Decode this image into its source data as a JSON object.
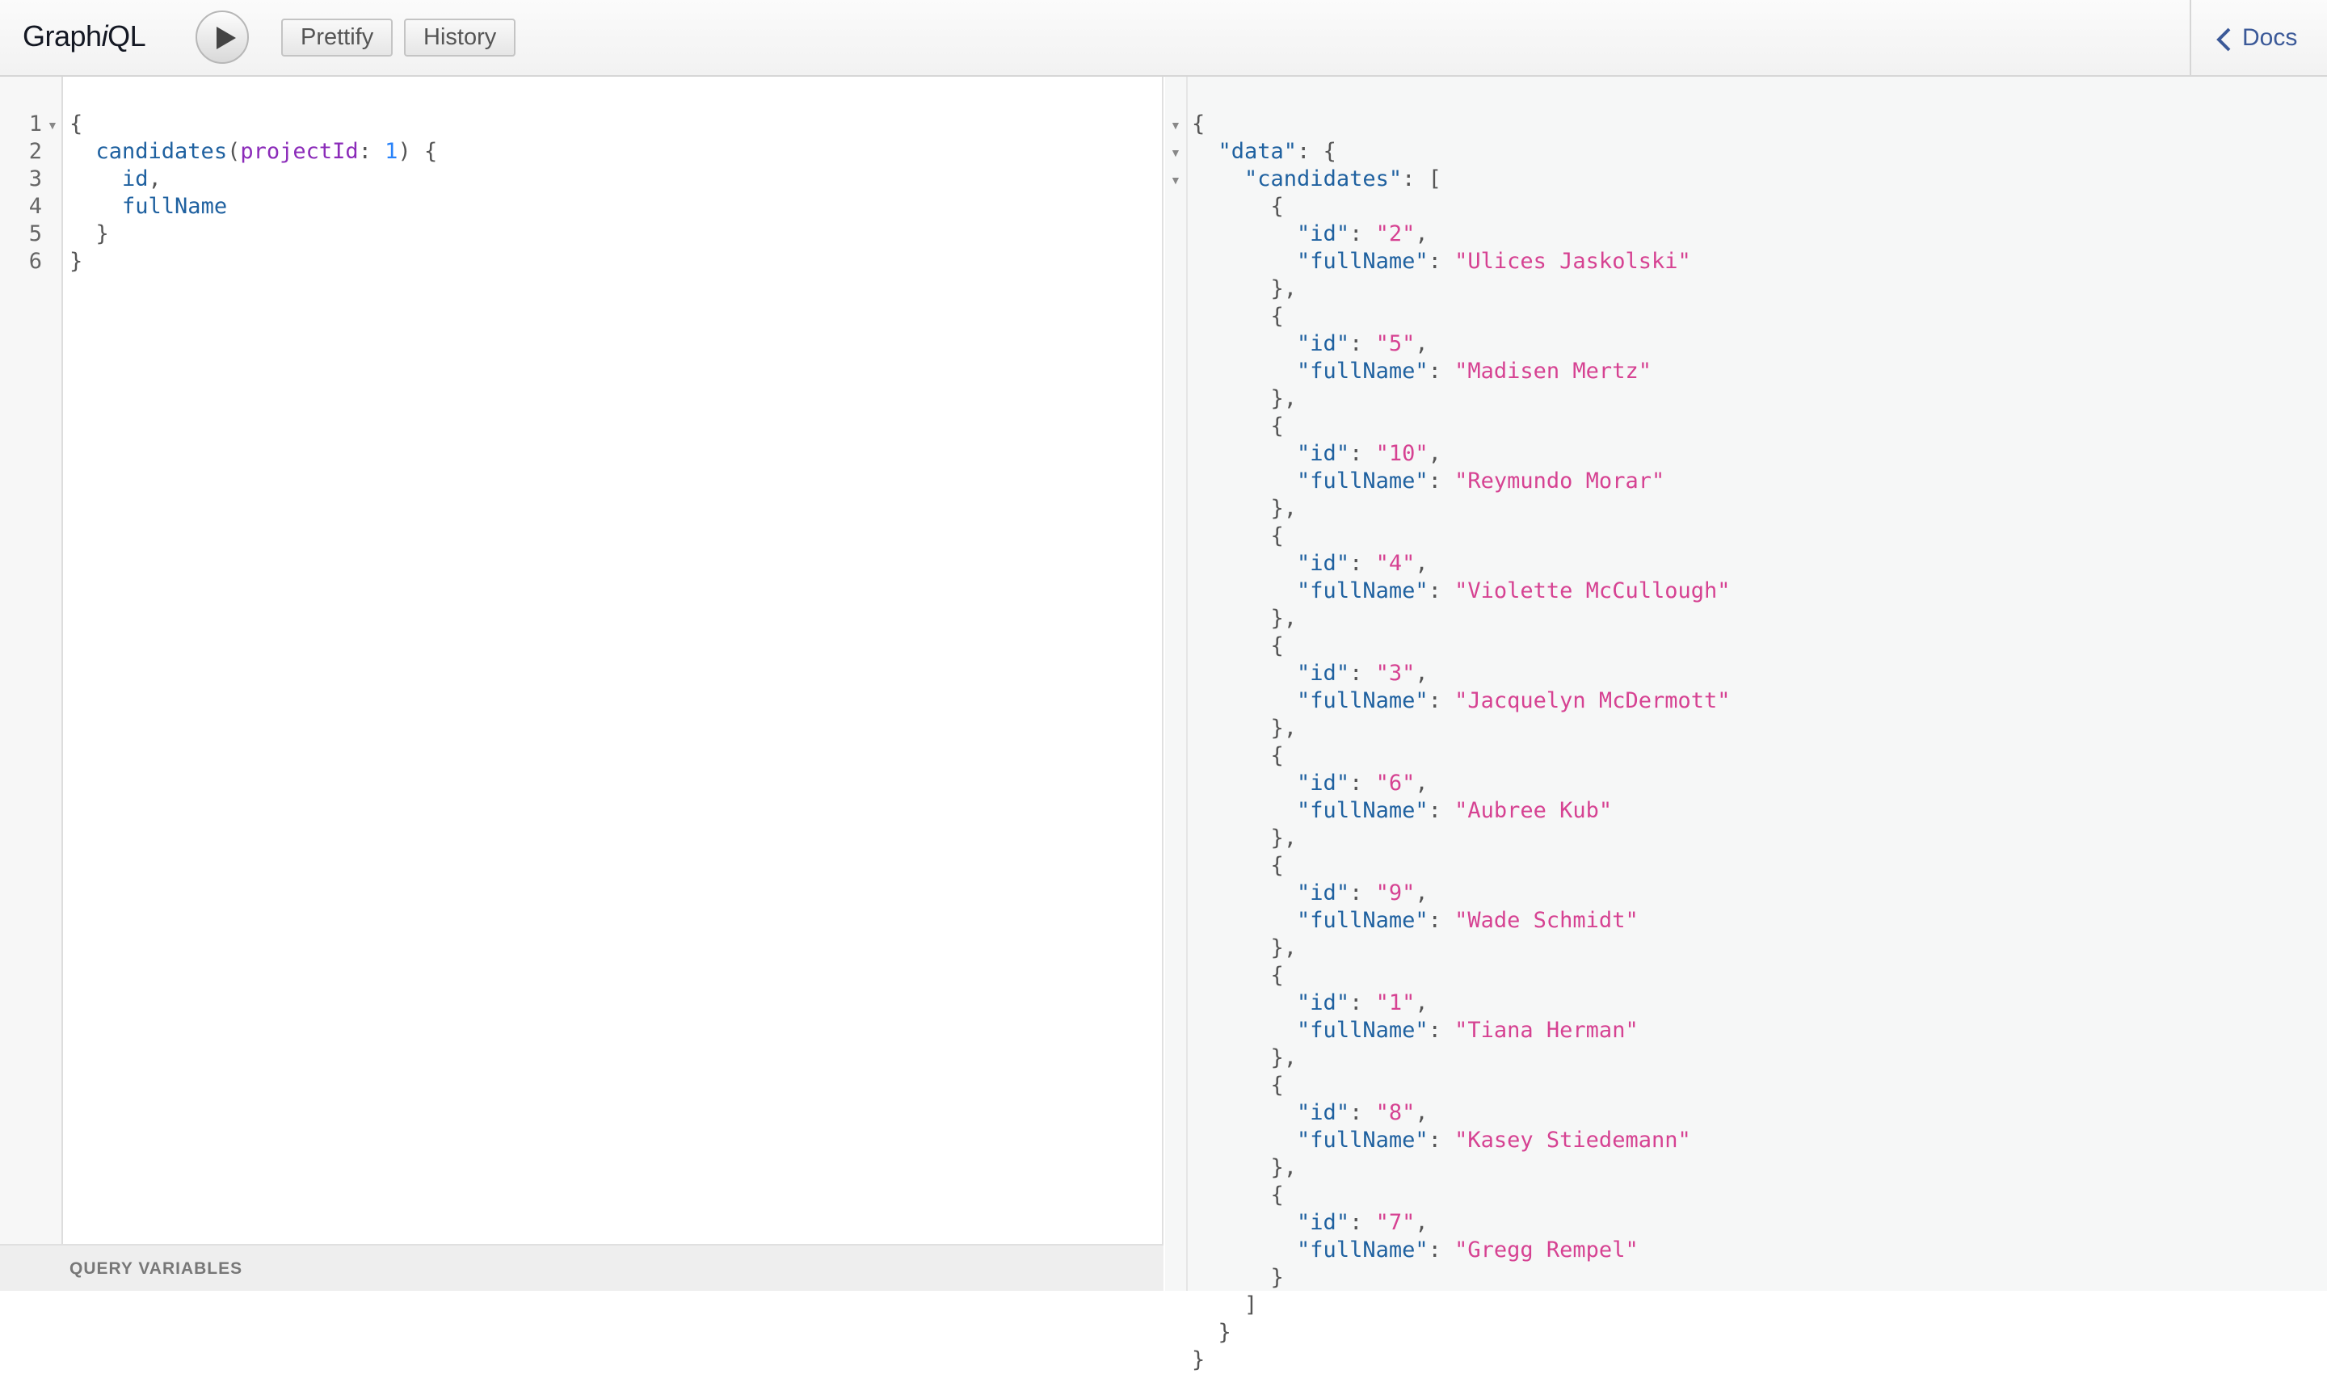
{
  "app": {
    "title_prefix": "Graph",
    "title_italic": "i",
    "title_suffix": "QL"
  },
  "toolbar": {
    "run_label": "Execute query",
    "prettify_label": "Prettify",
    "history_label": "History",
    "docs_label": "Docs"
  },
  "editor": {
    "line_numbers": [
      "1",
      "2",
      "3",
      "4",
      "5",
      "6"
    ],
    "query": {
      "root_field": "candidates",
      "arg_name": "projectId",
      "arg_value": "1",
      "fields": [
        "id",
        "fullName"
      ]
    }
  },
  "variables": {
    "label": "QUERY VARIABLES"
  },
  "result": {
    "data_key": "\"data\"",
    "list_key": "\"candidates\"",
    "id_key": "\"id\"",
    "name_key": "\"fullName\"",
    "candidates": [
      {
        "id": "2",
        "fullName": "Ulices Jaskolski"
      },
      {
        "id": "5",
        "fullName": "Madisen Mertz"
      },
      {
        "id": "10",
        "fullName": "Reymundo Morar"
      },
      {
        "id": "4",
        "fullName": "Violette McCullough"
      },
      {
        "id": "3",
        "fullName": "Jacquelyn McDermott"
      },
      {
        "id": "6",
        "fullName": "Aubree Kub"
      },
      {
        "id": "9",
        "fullName": "Wade Schmidt"
      },
      {
        "id": "1",
        "fullName": "Tiana Herman"
      },
      {
        "id": "8",
        "fullName": "Kasey Stiedemann"
      },
      {
        "id": "7",
        "fullName": "Gregg Rempel"
      }
    ]
  }
}
